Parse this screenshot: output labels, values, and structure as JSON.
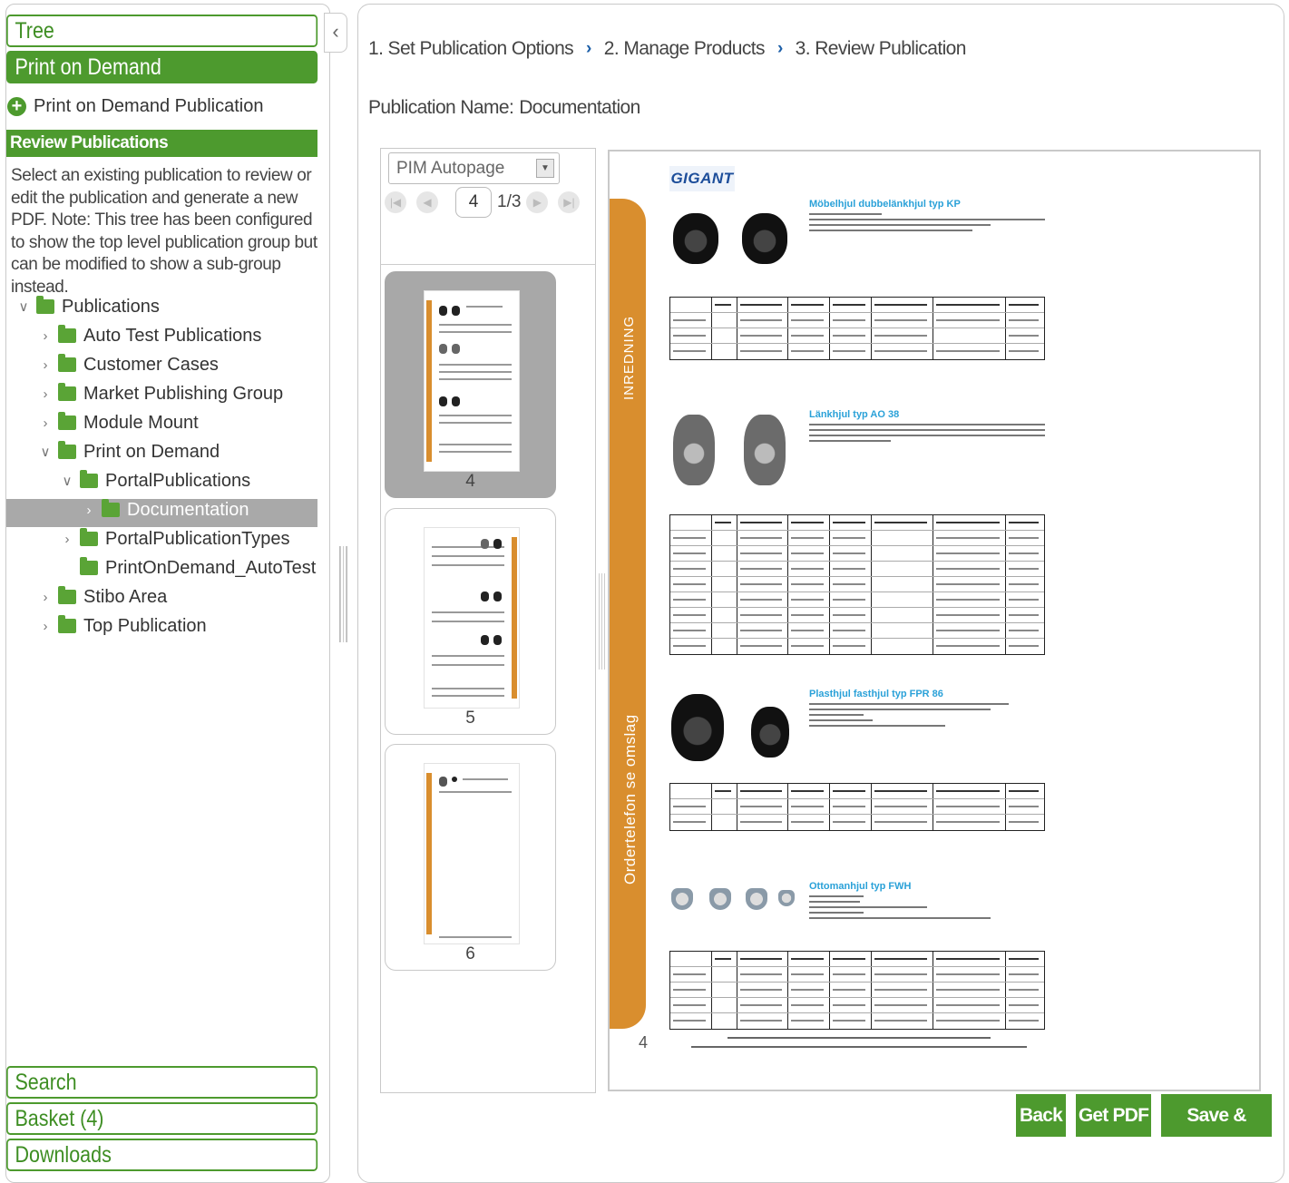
{
  "left": {
    "tree_tab": "Tree",
    "pod_tab": "Print on Demand",
    "pod_publication_link": "Print on Demand Publication",
    "review_header": "Review Publications",
    "description": "Select an existing publication to review or edit the publication and generate a new PDF. Note: This tree has been configured to show the top level publication group but can be modified to show a sub-group instead.",
    "tree": [
      {
        "label": "Publications",
        "expanded": true
      },
      {
        "label": "Auto Test Publications"
      },
      {
        "label": "Customer Cases"
      },
      {
        "label": "Market Publishing Group"
      },
      {
        "label": "Module Mount"
      },
      {
        "label": "Print on Demand",
        "expanded": true
      },
      {
        "label": "PortalPublications",
        "expanded": true
      },
      {
        "label": "Documentation",
        "selected": true
      },
      {
        "label": "PortalPublicationTypes"
      },
      {
        "label": "PrintOnDemand_AutoTest"
      },
      {
        "label": "Stibo Area"
      },
      {
        "label": "Top Publication"
      }
    ],
    "search_tab": "Search",
    "basket_tab": "Basket (4)",
    "downloads_tab": "Downloads"
  },
  "steps": [
    "1. Set Publication Options",
    "2. Manage Products",
    "3. Review Publication"
  ],
  "publication_name": {
    "label": "Publication Name:",
    "value": "Documentation"
  },
  "viewer": {
    "template_select": "PIM Autopage",
    "current_page": "4",
    "page_total": "1/3",
    "thumbnails": [
      "4",
      "5",
      "6"
    ],
    "page": {
      "logo": "GIGANT",
      "band_text_top": "INREDNING",
      "band_text_bottom": "Ordertelefon se omslag",
      "page_number": "4",
      "products": [
        {
          "title": "Möbelhjul dubbelänkhjul typ KP"
        },
        {
          "title": "Länkhjul typ AO 38"
        },
        {
          "title": "Plasthjul fasthjul typ FPR 86"
        },
        {
          "title": "Ottomanhjul typ FWH"
        }
      ]
    }
  },
  "buttons": {
    "back": "Back",
    "get_pdf": "Get PDF",
    "save_finish": "Save & Finish"
  },
  "colors": {
    "accent": "#4d9a2e",
    "band": "#d98e2e",
    "link": "#2aa1d8"
  }
}
